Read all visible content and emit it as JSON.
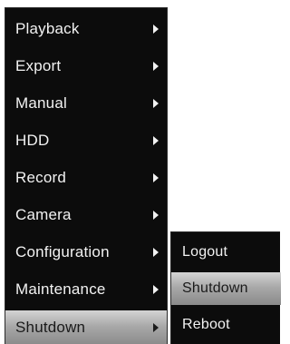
{
  "main_menu": {
    "items": [
      {
        "label": "Playback"
      },
      {
        "label": "Export"
      },
      {
        "label": "Manual"
      },
      {
        "label": "HDD"
      },
      {
        "label": "Record"
      },
      {
        "label": "Camera"
      },
      {
        "label": "Configuration"
      },
      {
        "label": "Maintenance"
      },
      {
        "label": "Shutdown"
      }
    ],
    "selected_index": 8
  },
  "sub_menu": {
    "items": [
      {
        "label": "Logout"
      },
      {
        "label": "Shutdown"
      },
      {
        "label": "Reboot"
      }
    ],
    "selected_index": 1
  },
  "colors": {
    "menu_background": "#0c0c0c",
    "menu_text": "#f2f2f2",
    "highlight": "#a9a9a9",
    "highlight_text": "#1a1a1a"
  },
  "icons": {
    "submenu_arrow": "chevron-right-icon"
  }
}
